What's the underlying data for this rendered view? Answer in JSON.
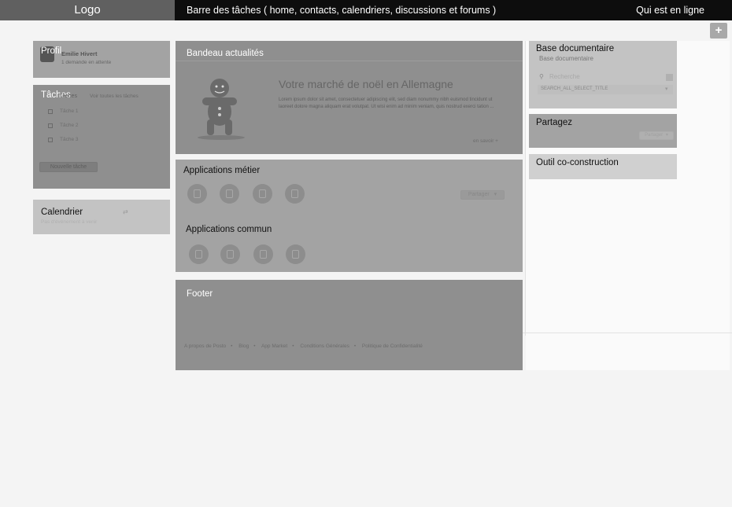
{
  "topbar": {
    "logo": "Logo",
    "taskbar": "Barre des tâches ( home, contacts, calendriers, discussions et forums )",
    "online": "Qui est en ligne",
    "plus": "+"
  },
  "profile": {
    "title": "Profil",
    "name": "Emilie Hivert",
    "pending": "1 demande en attente"
  },
  "tasks": {
    "title": "Tâches",
    "mini_title": "Tâches",
    "see_all": "Voir toutes les tâches",
    "items": [
      "Tâche 1",
      "Tâche 2",
      "Tâche 3"
    ],
    "new_button": "Nouvelle tâche"
  },
  "calendar": {
    "title": "Calendrier",
    "subtitle": "Pas d'événement à venir"
  },
  "news": {
    "title": "Bandeau actualités",
    "headline": "Votre marché de noël en Allemagne",
    "body": "Lorem ipsum dolor sit amet, consectetuer adipiscing elit, sed diam nonummy nibh euismod tincidunt ut laoreet dolore magna aliquam erat volutpat. Ut wisi enim ad minim veniam, quis nostrud exerci tation ...",
    "more": "en savoir +"
  },
  "apps": {
    "title_business": "Applications métier",
    "title_common": "Applications commun",
    "share_button": "Partager"
  },
  "footer": {
    "title": "Footer",
    "links": [
      "A propos de Posto",
      "Blog",
      "App Market",
      "Conditions Générales",
      "Politique de Confidentialité"
    ]
  },
  "docs": {
    "title": "Base documentaire",
    "subtitle": "Base documentaire",
    "search_placeholder": "Recherche",
    "select_label": "SEARCH_ALL_SELECT_TITLE"
  },
  "share": {
    "title": "Partagez",
    "button": "Partager"
  },
  "coconstruction": {
    "title": "Outil co-construction"
  }
}
